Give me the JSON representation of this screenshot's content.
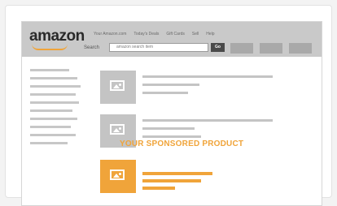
{
  "browser": {
    "logo_text": "amazon",
    "nav_links": [
      "Your Amazon.com",
      "Today's Deals",
      "Gift Cards",
      "Sell",
      "Help"
    ],
    "search_label": "Search",
    "search_value": "amazon search item",
    "go_label": "Go"
  },
  "sponsored": {
    "title": "YOUR SPONSORED PRODUCT"
  },
  "colors": {
    "accent": "#f0a43a",
    "placeholder_gray": "#c4c4c4",
    "topbar": "#c9c9c9"
  },
  "icons": [
    "image-placeholder-icon"
  ]
}
